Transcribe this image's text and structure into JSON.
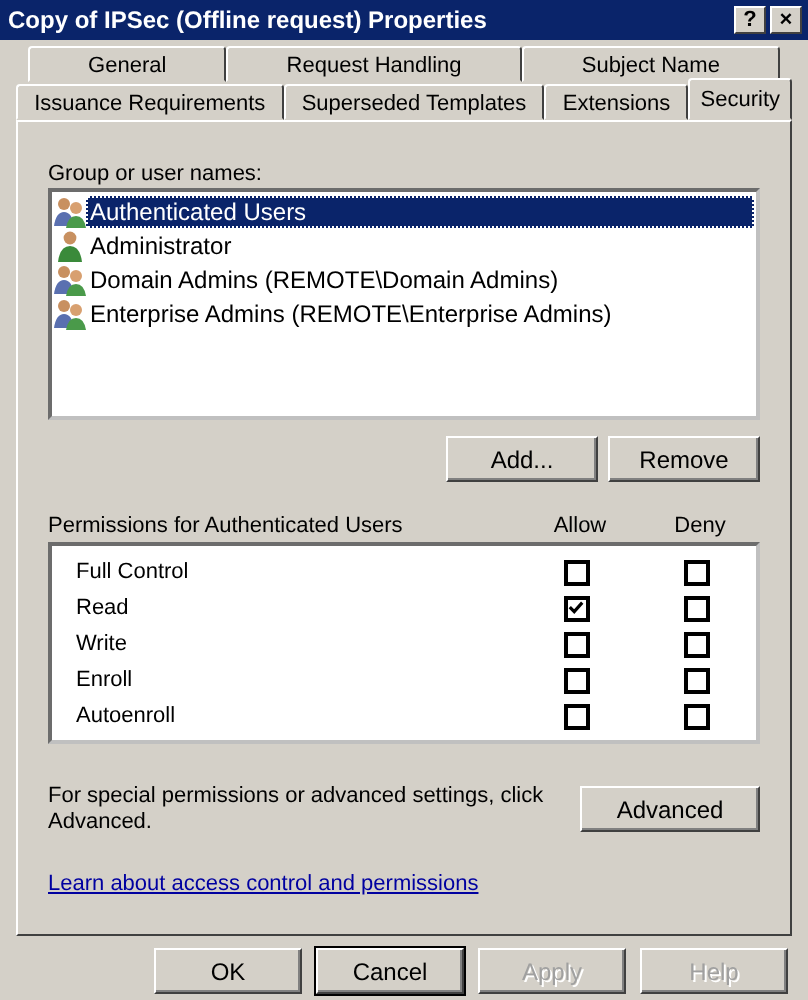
{
  "window": {
    "title": "Copy of IPSec (Offline request) Properties",
    "help_button": "?",
    "close_button": "×"
  },
  "tab_rows": [
    {
      "tabs": [
        {
          "label": "General",
          "selected": false
        },
        {
          "label": "Request Handling",
          "selected": false
        },
        {
          "label": "Subject Name",
          "selected": false
        }
      ]
    },
    {
      "tabs": [
        {
          "label": "Issuance Requirements",
          "selected": false
        },
        {
          "label": "Superseded Templates",
          "selected": false
        },
        {
          "label": "Extensions",
          "selected": false
        },
        {
          "label": "Security",
          "selected": true
        }
      ]
    }
  ],
  "users_label": "Group or user names:",
  "users": [
    {
      "name": "Authenticated Users",
      "kind": "group",
      "selected": true
    },
    {
      "name": "Administrator",
      "kind": "user",
      "selected": false
    },
    {
      "name": "Domain Admins (REMOTE\\Domain Admins)",
      "kind": "group",
      "selected": false
    },
    {
      "name": "Enterprise Admins (REMOTE\\Enterprise Admins)",
      "kind": "group",
      "selected": false
    }
  ],
  "user_buttons": [
    {
      "label": "Add..."
    },
    {
      "label": "Remove"
    }
  ],
  "permissions_label": "Permissions for Authenticated Users",
  "allow_header": "Allow",
  "deny_header": "Deny",
  "permissions": [
    {
      "name": "Full Control",
      "allow": false,
      "deny": false
    },
    {
      "name": "Read",
      "allow": true,
      "deny": false
    },
    {
      "name": "Write",
      "allow": false,
      "deny": false
    },
    {
      "name": "Enroll",
      "allow": false,
      "deny": false
    },
    {
      "name": "Autoenroll",
      "allow": false,
      "deny": false
    }
  ],
  "advanced_text": "For special permissions or advanced settings, click Advanced.",
  "advanced_button": "Advanced",
  "link": "Learn about access control and permissions",
  "buttons": [
    {
      "label": "OK",
      "disabled": false,
      "focused": false
    },
    {
      "label": "Cancel",
      "disabled": false,
      "focused": true
    },
    {
      "label": "Apply",
      "disabled": true,
      "focused": false
    },
    {
      "label": "Help",
      "disabled": true,
      "focused": false
    }
  ]
}
